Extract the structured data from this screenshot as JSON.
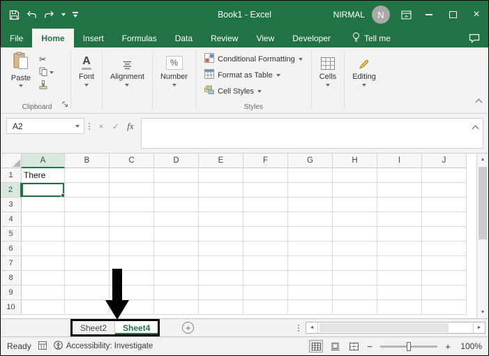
{
  "titlebar": {
    "title": "Book1 - Excel",
    "user_name": "NIRMAL",
    "avatar_initial": "N"
  },
  "ribbon_tabs": {
    "items": [
      {
        "label": "File",
        "type": "file"
      },
      {
        "label": "Home",
        "active": true
      },
      {
        "label": "Insert"
      },
      {
        "label": "Formulas"
      },
      {
        "label": "Data"
      },
      {
        "label": "Review"
      },
      {
        "label": "View"
      },
      {
        "label": "Developer"
      }
    ],
    "tell_me_label": "Tell me"
  },
  "ribbon": {
    "paste_label": "Paste",
    "clipboard_group_label": "Clipboard",
    "font_label": "Font",
    "font_icon_letter": "A",
    "alignment_label": "Alignment",
    "number_label": "Number",
    "number_icon": "%",
    "conditional_formatting_label": "Conditional Formatting",
    "format_as_table_label": "Format as Table",
    "cell_styles_label": "Cell Styles",
    "styles_group_label": "Styles",
    "cells_label": "Cells",
    "editing_label": "Editing"
  },
  "formula_bar": {
    "name_box_value": "A2",
    "cancel_glyph": "×",
    "enter_glyph": "✓",
    "insert_function_label": "fx",
    "formula_value": ""
  },
  "grid": {
    "columns": [
      "A",
      "B",
      "C",
      "D",
      "E",
      "F",
      "G",
      "H",
      "I",
      "J"
    ],
    "rows": [
      "1",
      "2",
      "3",
      "4",
      "5",
      "6",
      "7",
      "8",
      "9",
      "10"
    ],
    "cells": {
      "A1": "There"
    },
    "selection": {
      "cell": "A2",
      "column": "A",
      "row": "2"
    }
  },
  "sheet_bar": {
    "sheets": [
      {
        "name": "Sheet2",
        "active": false
      },
      {
        "name": "Sheet4",
        "active": true
      }
    ],
    "new_sheet_glyph": "+"
  },
  "status_bar": {
    "mode": "Ready",
    "accessibility_label": "Accessibility: Investigate",
    "zoom_out_glyph": "−",
    "zoom_in_glyph": "+",
    "zoom_level": "100%"
  },
  "icons": {
    "scroll_up": "▲",
    "scroll_down": "▼",
    "scroll_left": "◄",
    "scroll_right": "►",
    "cut": "✂"
  },
  "colors": {
    "excel_green": "#217346",
    "annotation": "#000000"
  }
}
